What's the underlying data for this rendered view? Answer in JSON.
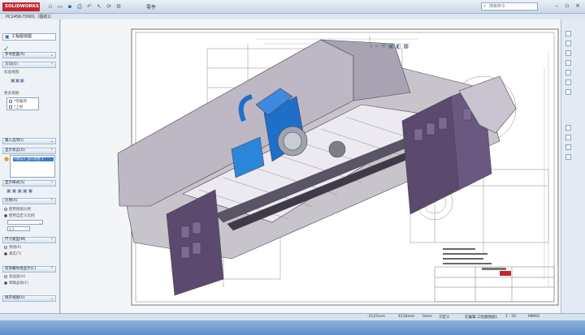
{
  "app": {
    "logo_text": "SOLIDWORKS",
    "title": "零件",
    "search_placeholder": "搜索命令"
  },
  "doc_tab": "PC2456-T0901（图纸1）",
  "panel": {
    "insert_view_label": "工程图视图",
    "groups": [
      {
        "title": "参考配置(R)"
      },
      {
        "title": "方向(O)",
        "lines": [
          "标准视图:",
          "更多视图:"
        ],
        "view_options": [
          "*等轴测",
          "*上视"
        ]
      },
      {
        "title": "输入选项(I)"
      },
      {
        "title": "显示状态(D)",
        "selected": "<默认>_显示状态 1"
      },
      {
        "title": "显示样式(S)"
      },
      {
        "title": "比例(A)",
        "options": [
          "使用图纸比例",
          "使用自定义比例"
        ],
        "scale_value": "1:1"
      },
      {
        "title": "尺寸类型(M)",
        "options": [
          "预测(P)",
          "真实(T)"
        ]
      },
      {
        "title": "装饰螺纹线显示(C)",
        "options": [
          "高品质(H)",
          "草稿品质(F)"
        ]
      },
      {
        "title": "保存视图(V)"
      }
    ]
  },
  "status": {
    "coord_x": "-3125mm",
    "coord_y": "4116mm",
    "coord_z": "0mm",
    "state": "欠定义",
    "edit": "在编辑 工程图图纸1",
    "scale": "1 : 50",
    "units": "MMGS"
  },
  "colors": {
    "brand": "#c4262e",
    "machine_frame": "#8a7a9a",
    "spindle": "#1e6fc9"
  }
}
